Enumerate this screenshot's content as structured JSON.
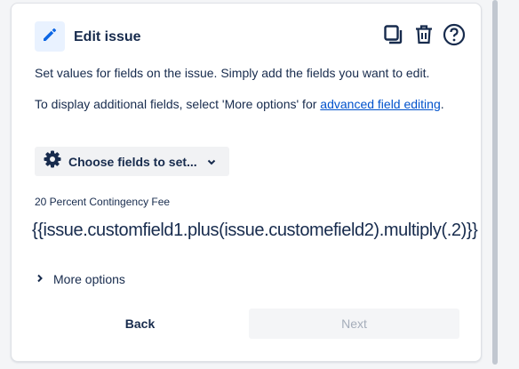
{
  "header": {
    "title": "Edit issue",
    "icons": {
      "edit": "pencil-icon",
      "copy": "copy-icon",
      "delete": "trash-icon",
      "help": "help-icon"
    }
  },
  "description": {
    "line1": "Set values for fields on the issue. Simply add the fields you want to edit.",
    "line2_prefix": "To display additional fields, select 'More options' for ",
    "line2_link": "advanced field editing",
    "line2_suffix": "."
  },
  "choose_fields": {
    "label": "Choose fields to set...",
    "icon": "gear-icon",
    "chevron": "chevron-down-icon"
  },
  "field": {
    "label": "20 Percent Contingency Fee",
    "value": "{{issue.customfield1.plus(issue.customefield2).multiply(.2)}}"
  },
  "more_options": {
    "label": "More options",
    "chevron": "chevron-right-icon"
  },
  "footer": {
    "back_label": "Back",
    "next_label": "Next"
  },
  "colors": {
    "accent": "#0052cc",
    "text": "#172b4d",
    "icon_bg": "#e9f2ff",
    "disabled_text": "#a5adba"
  }
}
